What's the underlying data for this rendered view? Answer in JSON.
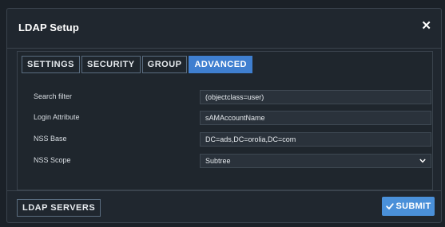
{
  "dialog": {
    "title": "LDAP Setup",
    "close_glyph": "✕"
  },
  "tabs": [
    {
      "label": "SETTINGS",
      "active": false
    },
    {
      "label": "SECURITY",
      "active": false
    },
    {
      "label": "GROUP",
      "active": false
    },
    {
      "label": "ADVANCED",
      "active": true
    }
  ],
  "form": {
    "search_filter": {
      "label": "Search filter",
      "value": "(objectclass=user)"
    },
    "login_attribute": {
      "label": "Login Attribute",
      "value": "sAMAccountName"
    },
    "nss_base": {
      "label": "NSS Base",
      "value": "DC=ads,DC=orolia,DC=com"
    },
    "nss_scope": {
      "label": "NSS Scope",
      "value": "Subtree",
      "icon": "chevron-down-icon"
    }
  },
  "footer": {
    "ldap_servers_label": "LDAP SERVERS",
    "submit_label": "SUBMIT",
    "submit_icon": "check-icon"
  },
  "colors": {
    "accent": "#3f7fd0",
    "submit": "#4a90d9",
    "background": "#20272f"
  }
}
